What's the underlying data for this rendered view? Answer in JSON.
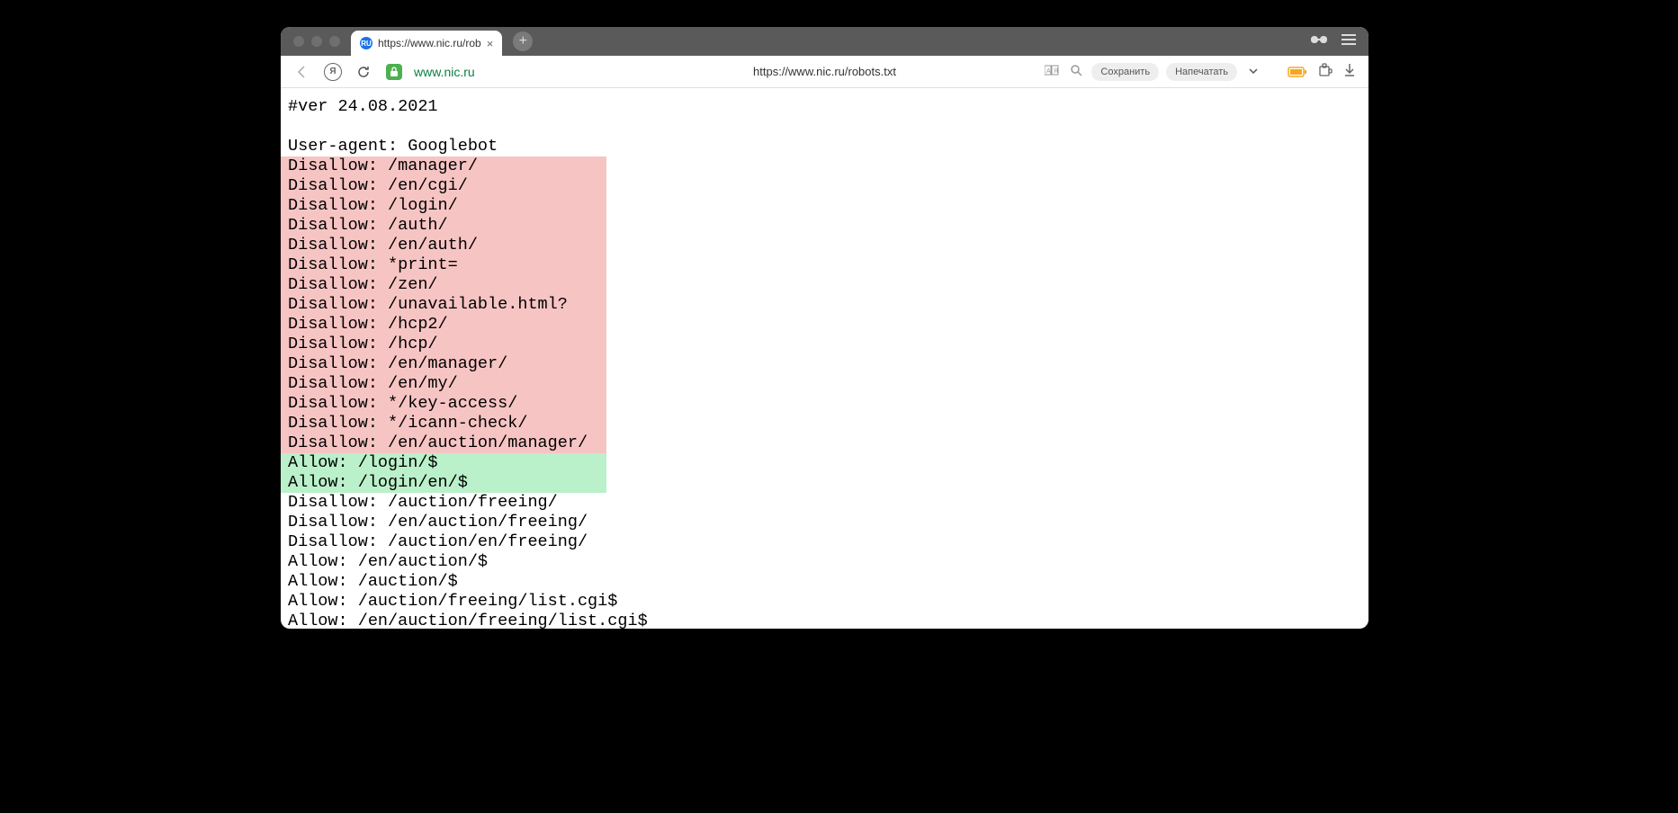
{
  "tab": {
    "favicon_text": "RU",
    "title": "https://www.nic.ru/rob",
    "close": "×"
  },
  "new_tab": "+",
  "address_bar": {
    "url_host": "www.nic.ru",
    "page_title": "https://www.nic.ru/robots.txt",
    "save_label": "Сохранить",
    "print_label": "Напечатать"
  },
  "content": {
    "lines": [
      {
        "text": "#ver 24.08.2021",
        "hl": "none"
      },
      {
        "text": "",
        "hl": "none"
      },
      {
        "text": "User-agent: Googlebot",
        "hl": "none"
      },
      {
        "text": "Disallow: /manager/",
        "hl": "red"
      },
      {
        "text": "Disallow: /en/cgi/",
        "hl": "red"
      },
      {
        "text": "Disallow: /login/",
        "hl": "red"
      },
      {
        "text": "Disallow: /auth/",
        "hl": "red"
      },
      {
        "text": "Disallow: /en/auth/",
        "hl": "red"
      },
      {
        "text": "Disallow: *print=",
        "hl": "red"
      },
      {
        "text": "Disallow: /zen/",
        "hl": "red"
      },
      {
        "text": "Disallow: /unavailable.html?",
        "hl": "red"
      },
      {
        "text": "Disallow: /hcp2/",
        "hl": "red"
      },
      {
        "text": "Disallow: /hcp/",
        "hl": "red"
      },
      {
        "text": "Disallow: /en/manager/",
        "hl": "red"
      },
      {
        "text": "Disallow: /en/my/",
        "hl": "red"
      },
      {
        "text": "Disallow: */key-access/",
        "hl": "red"
      },
      {
        "text": "Disallow: */icann-check/",
        "hl": "red"
      },
      {
        "text": "Disallow: /en/auction/manager/",
        "hl": "red"
      },
      {
        "text": "Allow: /login/$",
        "hl": "green"
      },
      {
        "text": "Allow: /login/en/$",
        "hl": "green"
      },
      {
        "text": "Disallow: /auction/freeing/",
        "hl": "none"
      },
      {
        "text": "Disallow: /en/auction/freeing/",
        "hl": "none"
      },
      {
        "text": "Disallow: /auction/en/freeing/",
        "hl": "none"
      },
      {
        "text": "Allow: /en/auction/$",
        "hl": "none"
      },
      {
        "text": "Allow: /auction/$",
        "hl": "none"
      },
      {
        "text": "Allow: /auction/freeing/list.cgi$",
        "hl": "none"
      },
      {
        "text": "Allow: /en/auction/freeing/list.cgi$",
        "hl": "none"
      }
    ]
  }
}
